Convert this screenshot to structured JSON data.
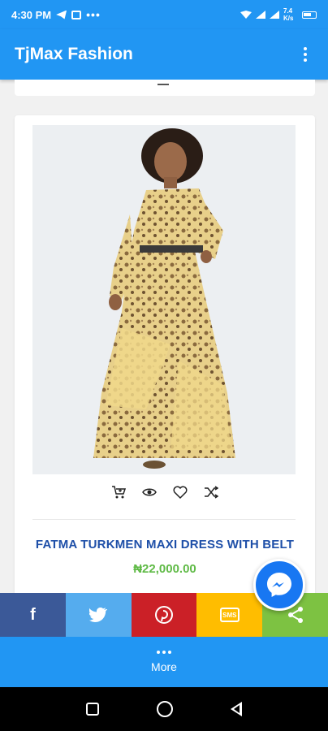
{
  "status_bar": {
    "time": "4:30 PM",
    "data_speed": "7.4 K/s"
  },
  "app_bar": {
    "title": "TjMax Fashion",
    "menu_icon": "more-vert-icon"
  },
  "product": {
    "title": "FATMA TURKMEN MAXI DRESS WITH BELT",
    "price": "₦22,000.00",
    "actions": [
      "cart-icon",
      "eye-icon",
      "heart-icon",
      "shuffle-icon"
    ]
  },
  "share": {
    "items": [
      "facebook",
      "twitter",
      "pinterest",
      "sms",
      "share"
    ],
    "sms_label": "SMS"
  },
  "more": {
    "label": "More"
  },
  "colors": {
    "primary": "#2196f3",
    "title": "#1e4fa8",
    "price": "#5fba46",
    "facebook": "#3b5998",
    "twitter": "#55acee",
    "pinterest": "#cb2027",
    "sms": "#ffbd00",
    "share": "#7dc242"
  }
}
